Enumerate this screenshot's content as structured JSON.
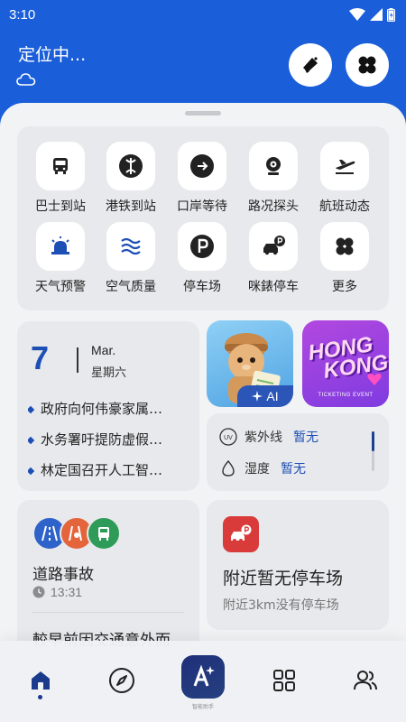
{
  "status": {
    "time": "3:10"
  },
  "header": {
    "location": "定位中..."
  },
  "services": [
    {
      "label": "巴士到站",
      "icon": "bus-icon"
    },
    {
      "label": "港铁到站",
      "icon": "mtr-icon"
    },
    {
      "label": "口岸等待",
      "icon": "arrow-right-icon"
    },
    {
      "label": "路况探头",
      "icon": "webcam-icon"
    },
    {
      "label": "航班动态",
      "icon": "plane-icon"
    },
    {
      "label": "天气预警",
      "icon": "siren-icon"
    },
    {
      "label": "空气质量",
      "icon": "waves-icon"
    },
    {
      "label": "停车场",
      "icon": "parking-icon"
    },
    {
      "label": "咪錶停车",
      "icon": "meter-parking-icon"
    },
    {
      "label": "更多",
      "icon": "more-grid-icon"
    }
  ],
  "news": {
    "day": "7",
    "month": "Mar.",
    "weekday": "星期六",
    "items": [
      "政府向何伟豪家属…",
      "水务署吁提防虚假…",
      "林定国召开人工智…"
    ]
  },
  "promo": {
    "ai_label": "AI",
    "hk_line1": "HONG",
    "hk_line2": "KONG",
    "hk_sub": "TICKETING EVENT"
  },
  "environment": {
    "uv_label": "紫外线",
    "uv_value": "暂无",
    "humidity_label": "湿度",
    "humidity_value": "暂无",
    "uv_icon_text": "UV"
  },
  "traffic": {
    "title": "道路事故",
    "time": "13:31",
    "next": "較早前因交通意外而"
  },
  "parking": {
    "title": "附近暂无停车场",
    "subtitle": "附近3km没有停车场"
  },
  "tabbar": {
    "ai_caption": "智能助手"
  },
  "colors": {
    "brand_blue": "#1a5fd9",
    "accent_navy": "#1d4fb4",
    "alert_red": "#d93b3b"
  }
}
